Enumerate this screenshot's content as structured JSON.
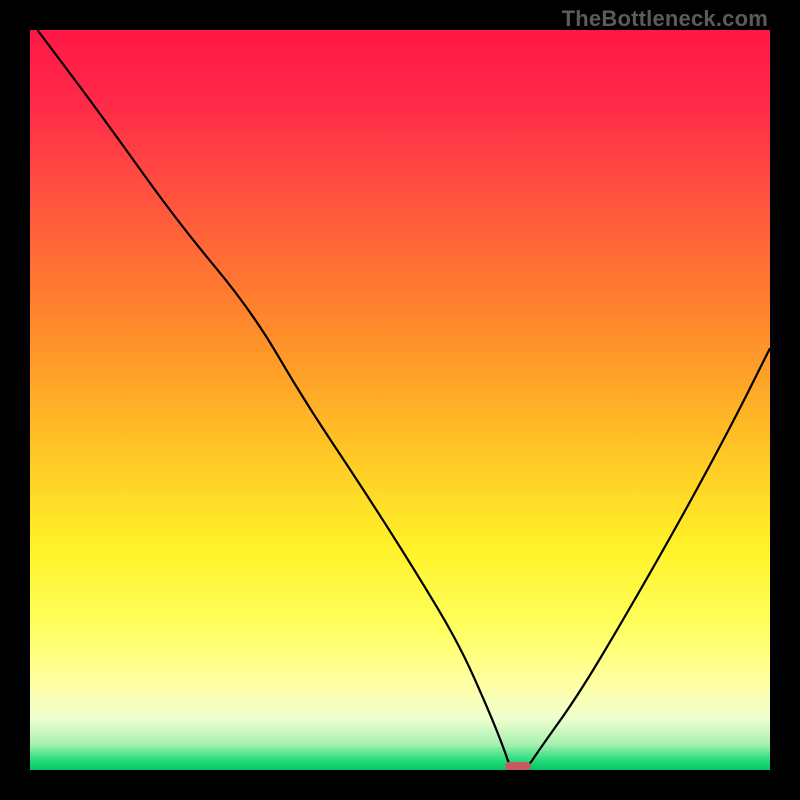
{
  "watermark": "TheBottleneck.com",
  "colors": {
    "black": "#000000",
    "curve": "#000000",
    "marker": "#c85a5f",
    "gradient_stops": [
      {
        "pos": 0.0,
        "color": "#ff1744"
      },
      {
        "pos": 0.1,
        "color": "#ff2a49"
      },
      {
        "pos": 0.25,
        "color": "#ff5a3c"
      },
      {
        "pos": 0.4,
        "color": "#ff8a2b"
      },
      {
        "pos": 0.55,
        "color": "#ffbf25"
      },
      {
        "pos": 0.7,
        "color": "#fff229"
      },
      {
        "pos": 0.8,
        "color": "#ffff5a"
      },
      {
        "pos": 0.88,
        "color": "#ffffa0"
      },
      {
        "pos": 0.93,
        "color": "#f0ffd0"
      },
      {
        "pos": 0.965,
        "color": "#a8f0b0"
      },
      {
        "pos": 0.985,
        "color": "#30dd80"
      },
      {
        "pos": 1.0,
        "color": "#00c864"
      }
    ]
  },
  "chart_data": {
    "type": "line",
    "title": "",
    "xlabel": "",
    "ylabel": "",
    "xlim": [
      0,
      100
    ],
    "ylim": [
      0,
      100
    ],
    "x": [
      1,
      10,
      20,
      30,
      37,
      45,
      52,
      58,
      62,
      64,
      65,
      67,
      69,
      74,
      80,
      88,
      95,
      100
    ],
    "values": [
      100,
      88,
      74,
      62,
      50,
      38,
      27,
      17,
      8,
      3,
      0,
      0,
      3,
      10,
      20,
      34,
      47,
      57
    ],
    "marker": {
      "x": 66,
      "y": 0,
      "w_pct": 3.5,
      "h_pct": 1.2
    }
  }
}
